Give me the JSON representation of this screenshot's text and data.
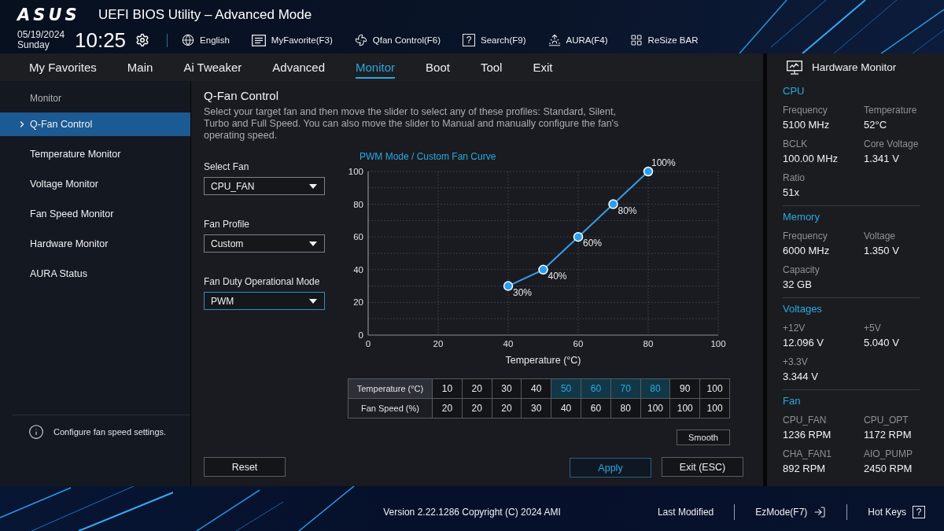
{
  "header": {
    "logo": "ASUS",
    "title": "UEFI BIOS Utility – Advanced Mode",
    "date": "05/19/2024",
    "day": "Sunday",
    "time": "10:25",
    "toolbar": [
      {
        "label": "English"
      },
      {
        "label": "MyFavorite(F3)"
      },
      {
        "label": "Qfan Control(F6)"
      },
      {
        "label": "Search(F9)",
        "glyph": "?"
      },
      {
        "label": "AURA(F4)"
      },
      {
        "label": "ReSize BAR"
      }
    ]
  },
  "tabs": [
    {
      "label": "My Favorites",
      "selected": false
    },
    {
      "label": "Main",
      "selected": false
    },
    {
      "label": "Ai Tweaker",
      "selected": false
    },
    {
      "label": "Advanced",
      "selected": false
    },
    {
      "label": "Monitor",
      "selected": true
    },
    {
      "label": "Boot",
      "selected": false
    },
    {
      "label": "Tool",
      "selected": false
    },
    {
      "label": "Exit",
      "selected": false
    }
  ],
  "sidebar": {
    "heading": "Monitor",
    "items": [
      {
        "label": "Q-Fan Control",
        "selected": true
      },
      {
        "label": "Temperature Monitor",
        "selected": false
      },
      {
        "label": "Voltage Monitor",
        "selected": false
      },
      {
        "label": "Fan Speed Monitor",
        "selected": false
      },
      {
        "label": "Hardware Monitor",
        "selected": false
      },
      {
        "label": "AURA Status",
        "selected": false
      }
    ],
    "help": "Configure fan speed settings."
  },
  "content": {
    "title": "Q-Fan Control",
    "description": "Select your target fan and then move the slider to select any of these profiles: Standard, Silent, Turbo and Full Speed. You can also move the slider to Manual and manually configure the fan's operating speed.",
    "fields": [
      {
        "label": "Select Fan",
        "value": "CPU_FAN",
        "focused": false
      },
      {
        "label": "Fan Profile",
        "value": "Custom",
        "focused": false
      },
      {
        "label": "Fan Duty Operational Mode",
        "value": "PWM",
        "focused": true
      }
    ],
    "chart_data": {
      "type": "line",
      "title": "PWM Mode / Custom Fan Curve",
      "xlabel": "Temperature (°C)",
      "x": [
        40,
        50,
        60,
        70,
        80
      ],
      "values": [
        30,
        40,
        60,
        80,
        100
      ],
      "xlim": [
        0,
        100
      ],
      "ylim": [
        0,
        100
      ],
      "xticks": [
        0,
        20,
        40,
        60,
        80,
        100
      ],
      "yticks": [
        0,
        20,
        40,
        60,
        80,
        100
      ],
      "grid": true,
      "marker": true,
      "value_labels": [
        "30%",
        "40%",
        "60%",
        "80%",
        "100%"
      ]
    },
    "table": {
      "rows": [
        {
          "header": "Temperature (°C)",
          "cells": [
            {
              "value": "10",
              "highlighted": false
            },
            {
              "value": "20",
              "highlighted": false
            },
            {
              "value": "30",
              "highlighted": false
            },
            {
              "value": "40",
              "highlighted": false
            },
            {
              "value": "50",
              "highlighted": true
            },
            {
              "value": "60",
              "highlighted": true
            },
            {
              "value": "70",
              "highlighted": true
            },
            {
              "value": "80",
              "highlighted": true
            },
            {
              "value": "90",
              "highlighted": false
            },
            {
              "value": "100",
              "highlighted": false
            }
          ]
        },
        {
          "header": "Fan Speed (%)",
          "cells": [
            {
              "value": "20",
              "highlighted": false
            },
            {
              "value": "20",
              "highlighted": false
            },
            {
              "value": "20",
              "highlighted": false
            },
            {
              "value": "30",
              "highlighted": false
            },
            {
              "value": "40",
              "highlighted": false
            },
            {
              "value": "60",
              "highlighted": false
            },
            {
              "value": "80",
              "highlighted": false
            },
            {
              "value": "100",
              "highlighted": false
            },
            {
              "value": "100",
              "highlighted": false
            },
            {
              "value": "100",
              "highlighted": false
            }
          ]
        }
      ]
    },
    "buttons": {
      "smooth": "Smooth",
      "reset": "Reset",
      "apply": "Apply",
      "exit": "Exit (ESC)"
    }
  },
  "hardware_monitor": {
    "title": "Hardware Monitor",
    "sections": [
      {
        "title": "CPU",
        "items": [
          {
            "label": "Frequency",
            "value": "5100 MHz"
          },
          {
            "label": "Temperature",
            "value": "52°C"
          },
          {
            "label": "BCLK",
            "value": "100.00 MHz"
          },
          {
            "label": "Core Voltage",
            "value": "1.341 V"
          },
          {
            "label": "Ratio",
            "value": "51x"
          }
        ]
      },
      {
        "title": "Memory",
        "items": [
          {
            "label": "Frequency",
            "value": "6000 MHz"
          },
          {
            "label": "Voltage",
            "value": "1.350 V"
          },
          {
            "label": "Capacity",
            "value": "32 GB"
          }
        ]
      },
      {
        "title": "Voltages",
        "items": [
          {
            "label": "+12V",
            "value": "12.096 V"
          },
          {
            "label": "+5V",
            "value": "5.040 V"
          },
          {
            "label": "+3.3V",
            "value": "3.344 V"
          }
        ]
      },
      {
        "title": "Fan",
        "items": [
          {
            "label": "CPU_FAN",
            "value": "1236 RPM"
          },
          {
            "label": "CPU_OPT",
            "value": "1172 RPM"
          },
          {
            "label": "CHA_FAN1",
            "value": "892 RPM"
          },
          {
            "label": "AIO_PUMP",
            "value": "2450 RPM"
          }
        ]
      }
    ]
  },
  "footer": {
    "version": "Version 2.22.1286 Copyright (C) 2024 AMI",
    "actions": [
      {
        "label": "Last Modified"
      },
      {
        "label": "EzMode(F7)"
      },
      {
        "label": "Hot Keys",
        "glyph": "?"
      }
    ]
  }
}
